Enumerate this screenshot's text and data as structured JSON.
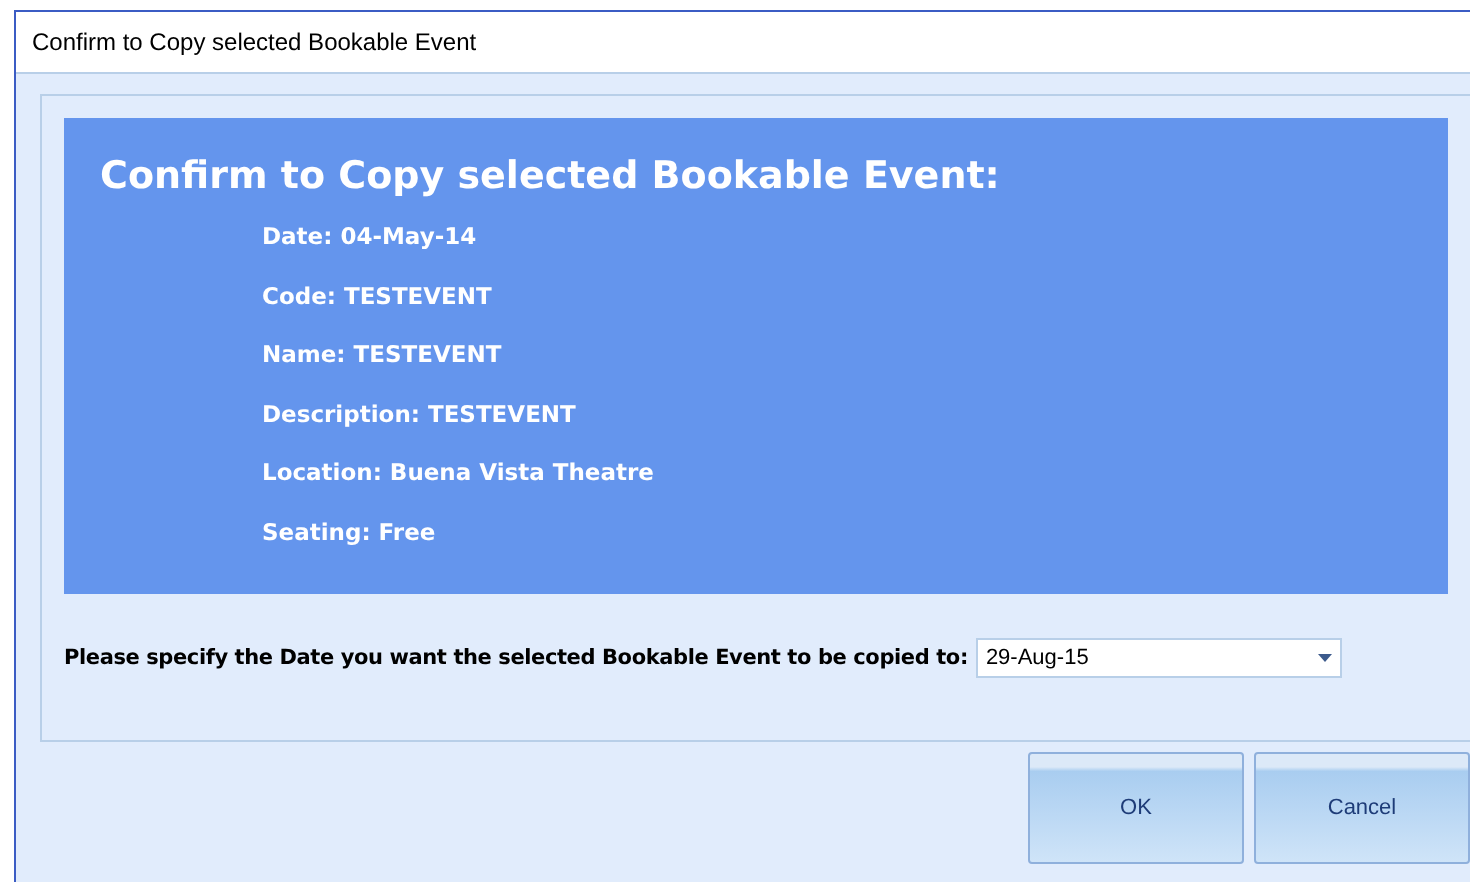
{
  "window": {
    "title": "Confirm to Copy selected Bookable Event"
  },
  "summary": {
    "heading": "Confirm to Copy selected Bookable Event:",
    "details": [
      "Date: 04-May-14",
      "Code: TESTEVENT",
      "Name: TESTEVENT",
      "Description: TESTEVENT",
      "Location: Buena Vista Theatre",
      "Seating: Free"
    ]
  },
  "date_prompt": {
    "label": "Please specify the Date you want the selected Bookable Event to be copied to:",
    "value": "29-Aug-15"
  },
  "buttons": [
    "OK",
    "Cancel"
  ]
}
